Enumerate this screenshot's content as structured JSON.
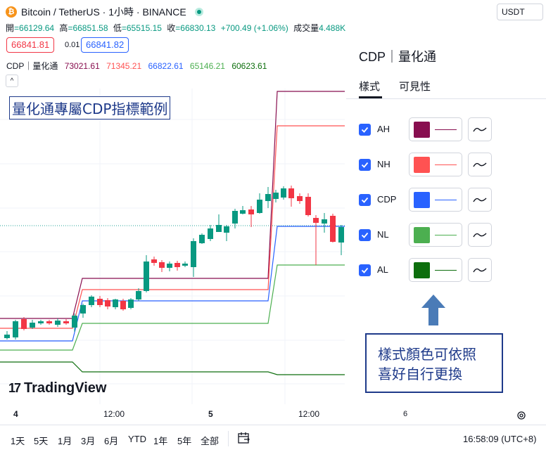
{
  "header": {
    "coin_glyph": "₿",
    "symbol": "Bitcoin / TetherUS · 1小時 · BINANCE",
    "currency": "USDT"
  },
  "ohlc": {
    "open_label": "開",
    "open": "=66129.64",
    "high_label": "高",
    "high": "=66851.58",
    "low_label": "低",
    "low": "=65515.15",
    "close_label": "收",
    "close": "=66830.13",
    "change": "+700.49 (+1.06%)",
    "volume_label": "成交量",
    "volume": "4.488K"
  },
  "trade": {
    "sell_price": "66841.81",
    "spread": "0.01",
    "buy_price": "66841.82"
  },
  "indicator": {
    "name": "CDP｜量化通",
    "ah": "73021.61",
    "nh": "71345.21",
    "cdp": "66822.61",
    "nl": "65146.21",
    "al": "60623.61",
    "collapse_glyph": "^"
  },
  "annotation_title": "量化通專屬CDP指標範例",
  "brand": {
    "mark": "17",
    "name": "TradingView"
  },
  "time_axis": {
    "t1": "4",
    "t2": "12:00",
    "t3": "5",
    "t4": "12:00"
  },
  "bottom_bar": {
    "ranges": [
      "1天",
      "5天",
      "1月",
      "3月",
      "6月",
      "YTD",
      "1年",
      "5年",
      "全部"
    ],
    "clock": "16:58:09 (UTC+8)"
  },
  "panel": {
    "title": "CDP｜量化通",
    "tabs": [
      "樣式",
      "可見性"
    ],
    "axis_label": "6",
    "rows": [
      {
        "label": "AH",
        "color": "#880e4f"
      },
      {
        "label": "NH",
        "color": "#ff5252"
      },
      {
        "label": "CDP",
        "color": "#2962ff"
      },
      {
        "label": "NL",
        "color": "#4caf50"
      },
      {
        "label": "AL",
        "color": "#0d6e0d"
      }
    ]
  },
  "note": {
    "line1": "樣式顏色可依照",
    "line2": "喜好自行更換"
  },
  "colors": {
    "up": "#089981",
    "down": "#f23645",
    "ah": "#880e4f",
    "nh": "#ff5252",
    "cdp": "#2962ff",
    "nl": "#4caf50",
    "al": "#0d6e0d"
  }
}
